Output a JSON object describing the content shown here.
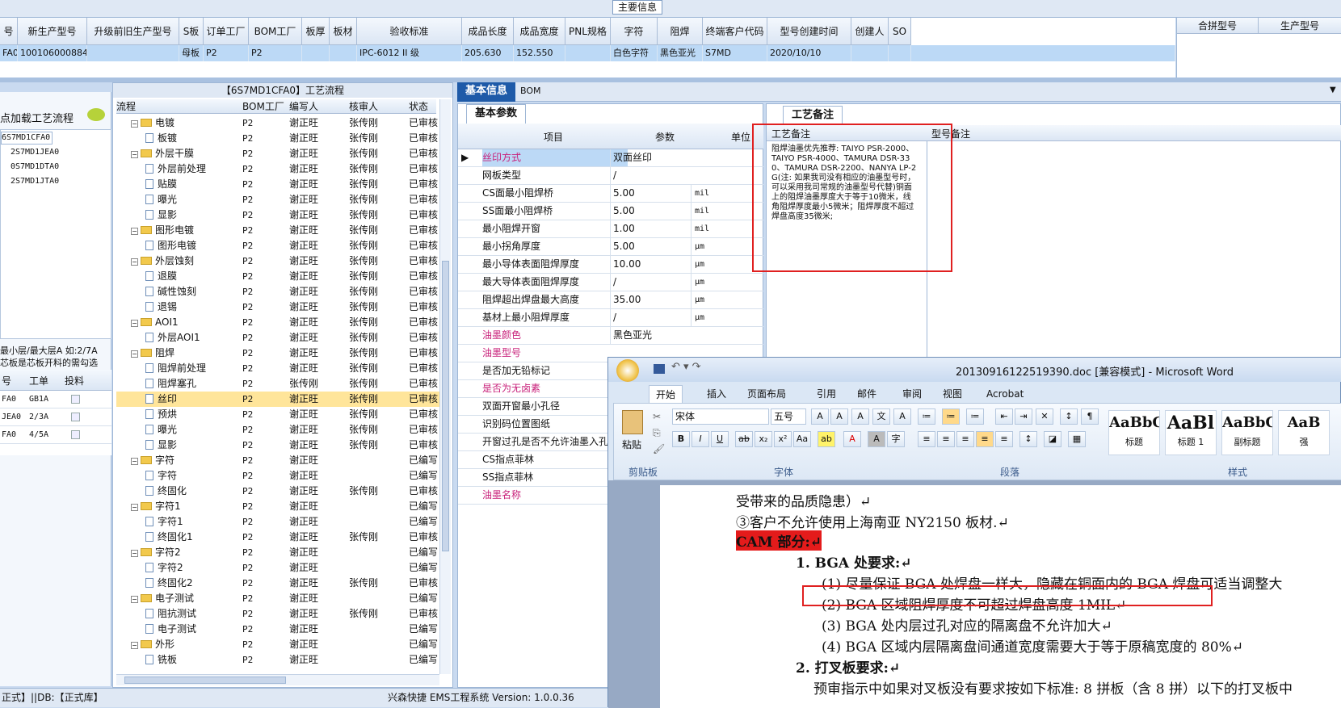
{
  "main_info": {
    "title": "主要信息",
    "columns": [
      "号",
      "新生产型号",
      "升级前旧生产型号",
      "S板",
      "订单工厂",
      "BOM工厂",
      "板厚",
      "板材",
      "验收标准",
      "成品长度",
      "成品宽度",
      "PNL规格",
      "字符",
      "阻焊",
      "终端客户代码",
      "型号创建时间",
      "创建人",
      "SO"
    ],
    "row": [
      "FA0",
      "10010600088445",
      "",
      "母板",
      "P2",
      "P2",
      "",
      "",
      "IPC-6012 II 级",
      "205.630",
      "152.550",
      "",
      "白色字符",
      "黑色亚光",
      "S7MD",
      "2020/10/10",
      "",
      ""
    ],
    "merge_cols": [
      "合拼型号",
      "生产型号"
    ]
  },
  "left": {
    "load_label": "点加载工艺流程",
    "tree": [
      "6S7MD1CFA0",
      "2S7MD1JEA0",
      "0S7MD1DTA0",
      "2S7MD1JTA0"
    ],
    "note1": "最小层/最大层A 如:2/7A",
    "note2": "芯板是芯板开料的需勾选",
    "grid_headers": [
      "号",
      "工单",
      "投料"
    ],
    "grid_rows": [
      [
        "FA0",
        "GB1A"
      ],
      [
        "JEA0",
        "2/3A"
      ],
      [
        "FA0",
        "4/5A"
      ]
    ]
  },
  "flow": {
    "title": "【6S7MD1CFA0】工艺流程",
    "headers": [
      "流程",
      "BOM工厂",
      "编写人",
      "核审人",
      "状态"
    ],
    "rows": [
      {
        "lvl": 1,
        "name": "电镀",
        "f": "P2",
        "w": "谢正旺",
        "r": "张传刚",
        "s": "已审核"
      },
      {
        "lvl": 2,
        "name": "板镀",
        "f": "P2",
        "w": "谢正旺",
        "r": "张传刚",
        "s": "已审核"
      },
      {
        "lvl": 1,
        "name": "外层干膜",
        "f": "P2",
        "w": "谢正旺",
        "r": "张传刚",
        "s": "已审核"
      },
      {
        "lvl": 2,
        "name": "外层前处理",
        "f": "P2",
        "w": "谢正旺",
        "r": "张传刚",
        "s": "已审核"
      },
      {
        "lvl": 2,
        "name": "贴膜",
        "f": "P2",
        "w": "谢正旺",
        "r": "张传刚",
        "s": "已审核"
      },
      {
        "lvl": 2,
        "name": "曝光",
        "f": "P2",
        "w": "谢正旺",
        "r": "张传刚",
        "s": "已审核"
      },
      {
        "lvl": 2,
        "name": "显影",
        "f": "P2",
        "w": "谢正旺",
        "r": "张传刚",
        "s": "已审核"
      },
      {
        "lvl": 1,
        "name": "图形电镀",
        "f": "P2",
        "w": "谢正旺",
        "r": "张传刚",
        "s": "已审核"
      },
      {
        "lvl": 2,
        "name": "图形电镀",
        "f": "P2",
        "w": "谢正旺",
        "r": "张传刚",
        "s": "已审核"
      },
      {
        "lvl": 1,
        "name": "外层蚀刻",
        "f": "P2",
        "w": "谢正旺",
        "r": "张传刚",
        "s": "已审核"
      },
      {
        "lvl": 2,
        "name": "退膜",
        "f": "P2",
        "w": "谢正旺",
        "r": "张传刚",
        "s": "已审核"
      },
      {
        "lvl": 2,
        "name": "碱性蚀刻",
        "f": "P2",
        "w": "谢正旺",
        "r": "张传刚",
        "s": "已审核"
      },
      {
        "lvl": 2,
        "name": "退锡",
        "f": "P2",
        "w": "谢正旺",
        "r": "张传刚",
        "s": "已审核"
      },
      {
        "lvl": 1,
        "name": "AOI1",
        "f": "P2",
        "w": "谢正旺",
        "r": "张传刚",
        "s": "已审核"
      },
      {
        "lvl": 2,
        "name": "外层AOI1",
        "f": "P2",
        "w": "谢正旺",
        "r": "张传刚",
        "s": "已审核"
      },
      {
        "lvl": 1,
        "name": "阻焊",
        "f": "P2",
        "w": "谢正旺",
        "r": "张传刚",
        "s": "已审核"
      },
      {
        "lvl": 2,
        "name": "阻焊前处理",
        "f": "P2",
        "w": "谢正旺",
        "r": "张传刚",
        "s": "已审核"
      },
      {
        "lvl": 2,
        "name": "阻焊塞孔",
        "f": "P2",
        "w": "张传刚",
        "r": "张传刚",
        "s": "已审核"
      },
      {
        "lvl": 2,
        "name": "丝印",
        "f": "P2",
        "w": "谢正旺",
        "r": "张传刚",
        "s": "已审核",
        "sel": true
      },
      {
        "lvl": 2,
        "name": "预烘",
        "f": "P2",
        "w": "谢正旺",
        "r": "张传刚",
        "s": "已审核"
      },
      {
        "lvl": 2,
        "name": "曝光",
        "f": "P2",
        "w": "谢正旺",
        "r": "张传刚",
        "s": "已审核"
      },
      {
        "lvl": 2,
        "name": "显影",
        "f": "P2",
        "w": "谢正旺",
        "r": "张传刚",
        "s": "已审核"
      },
      {
        "lvl": 1,
        "name": "字符",
        "f": "P2",
        "w": "谢正旺",
        "r": "",
        "s": "已编写"
      },
      {
        "lvl": 2,
        "name": "字符",
        "f": "P2",
        "w": "谢正旺",
        "r": "",
        "s": "已编写"
      },
      {
        "lvl": 2,
        "name": "终固化",
        "f": "P2",
        "w": "谢正旺",
        "r": "张传刚",
        "s": "已审核"
      },
      {
        "lvl": 1,
        "name": "字符1",
        "f": "P2",
        "w": "谢正旺",
        "r": "",
        "s": "已编写"
      },
      {
        "lvl": 2,
        "name": "字符1",
        "f": "P2",
        "w": "谢正旺",
        "r": "",
        "s": "已编写"
      },
      {
        "lvl": 2,
        "name": "终固化1",
        "f": "P2",
        "w": "谢正旺",
        "r": "张传刚",
        "s": "已审核"
      },
      {
        "lvl": 1,
        "name": "字符2",
        "f": "P2",
        "w": "谢正旺",
        "r": "",
        "s": "已编写"
      },
      {
        "lvl": 2,
        "name": "字符2",
        "f": "P2",
        "w": "谢正旺",
        "r": "",
        "s": "已编写"
      },
      {
        "lvl": 2,
        "name": "终固化2",
        "f": "P2",
        "w": "谢正旺",
        "r": "张传刚",
        "s": "已审核"
      },
      {
        "lvl": 1,
        "name": "电子测试",
        "f": "P2",
        "w": "谢正旺",
        "r": "",
        "s": "已编写"
      },
      {
        "lvl": 2,
        "name": "阻抗测试",
        "f": "P2",
        "w": "谢正旺",
        "r": "张传刚",
        "s": "已审核"
      },
      {
        "lvl": 2,
        "name": "电子测试",
        "f": "P2",
        "w": "谢正旺",
        "r": "",
        "s": "已编写"
      },
      {
        "lvl": 1,
        "name": "外形",
        "f": "P2",
        "w": "谢正旺",
        "r": "",
        "s": "已编写"
      },
      {
        "lvl": 2,
        "name": "铣板",
        "f": "P2",
        "w": "谢正旺",
        "r": "",
        "s": "已编写"
      }
    ]
  },
  "basic": {
    "tab_active": "基本信息",
    "tab2": "BOM",
    "subtab": "基本参数",
    "headers": [
      "项目",
      "参数",
      "单位"
    ],
    "rows": [
      {
        "n": "丝印方式",
        "v": "双面丝印",
        "u": "",
        "pink": true,
        "cur": true
      },
      {
        "n": "网板类型",
        "v": "/",
        "u": ""
      },
      {
        "n": "CS面最小阻焊桥",
        "v": "5.00",
        "u": "mil"
      },
      {
        "n": "SS面最小阻焊桥",
        "v": "5.00",
        "u": "mil"
      },
      {
        "n": "最小阻焊开窗",
        "v": "1.00",
        "u": "mil"
      },
      {
        "n": "最小拐角厚度",
        "v": "5.00",
        "u": "μm"
      },
      {
        "n": "最小导体表面阻焊厚度",
        "v": "10.00",
        "u": "μm"
      },
      {
        "n": "最大导体表面阻焊厚度",
        "v": "/",
        "u": "μm"
      },
      {
        "n": "阻焊超出焊盘最大高度",
        "v": "35.00",
        "u": "μm"
      },
      {
        "n": "基材上最小阻焊厚度",
        "v": "/",
        "u": "μm"
      },
      {
        "n": "油墨颜色",
        "v": "黑色亚光",
        "u": "",
        "pink": true
      },
      {
        "n": "油墨型号",
        "v": "",
        "u": "",
        "pink": true
      },
      {
        "n": "是否加无铅标记",
        "v": "",
        "u": ""
      },
      {
        "n": "是否为无卤素",
        "v": "",
        "u": "",
        "pink": true
      },
      {
        "n": "双面开窗最小孔径",
        "v": "",
        "u": ""
      },
      {
        "n": "识别码位置图纸",
        "v": "",
        "u": ""
      },
      {
        "n": "开窗过孔是否不允许油墨入孔",
        "v": "",
        "u": ""
      },
      {
        "n": "CS指点菲林",
        "v": "",
        "u": ""
      },
      {
        "n": "SS指点菲林",
        "v": "",
        "u": ""
      },
      {
        "n": "油墨名称",
        "v": "",
        "u": "",
        "pink": true
      }
    ]
  },
  "remarks": {
    "tab": "工艺备注",
    "col1": "工艺备注",
    "col2": "型号备注",
    "text": "阻焊油墨优先推荐: TAIYO PSR-2000、TAIYO PSR-4000、TAMURA DSR-330、TAMURA DSR-2200、NANYA LP-2G(注: 如果我司没有相应的油墨型号时，可以采用我司常规的油墨型号代替)铜面上的阻焊油墨厚度大于等于10微米，线角阻焊厚度最小5微米；阻焊厚度不超过焊盘高度35微米;"
  },
  "word": {
    "title": "20130916122519390.doc [兼容模式] - Microsoft Word",
    "tabs": [
      "开始",
      "插入",
      "页面布局",
      "引用",
      "邮件",
      "审阅",
      "视图",
      "Acrobat"
    ],
    "font": "宋体",
    "size": "五号",
    "paste": "粘贴",
    "groups": [
      "剪贴板",
      "字体",
      "段落",
      "样式"
    ],
    "styles": [
      {
        "p": "AaBbC",
        "l": "标题"
      },
      {
        "p": "AaBl",
        "l": "标题 1"
      },
      {
        "p": "AaBbC",
        "l": "副标题"
      },
      {
        "p": "AaB",
        "l": "强"
      }
    ],
    "lines": [
      "受带来的品质隐患）↵",
      "③客户不允许使用上海南亚 NY2150 板材.↵",
      "CAM 部分:↵",
      "1. BGA 处要求:↵",
      "(1) 尽量保证 BGA 处焊盘一样大，隐藏在铜面内的 BGA 焊盘可适当调整大",
      "(2) BGA 区域阻焊厚度不可超过焊盘高度 1MIL↵",
      "(3) BGA 处内层过孔对应的隔离盘不允许加大↵",
      "(4) BGA 区域内层隔离盘间通道宽度需要大于等于原稿宽度的 80%↵",
      "2. 打叉板要求:↵",
      "预审指示中如果对叉板没有要求按如下标准: 8 拼板（含 8 拼）以下的打叉板中"
    ]
  },
  "status": {
    "left": "正式】||DB:【正式库】",
    "right": "兴森快捷 EMS工程系统 Version: 1.0.0.36"
  },
  "colors": {
    "highlight": "#e02020",
    "selection": "#bcd9f6",
    "pink": "#c8207a"
  }
}
